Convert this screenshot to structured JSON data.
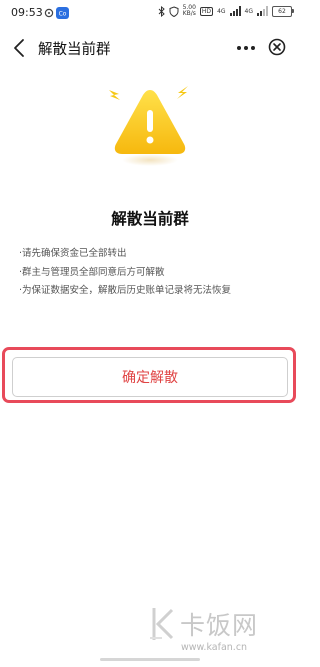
{
  "status_bar": {
    "time": "09:53",
    "speed_value": "5.00",
    "speed_unit": "KB/s",
    "hd_badge": "HD",
    "signal_label": "4G",
    "signal_label_2": "4G",
    "battery": "62"
  },
  "nav": {
    "title": "解散当前群"
  },
  "content": {
    "title": "解散当前群",
    "notes": [
      "·请先确保资金已全部转出",
      "·群主与管理员全部同意后方可解散",
      "·为保证数据安全，解散后历史账单记录将无法恢复"
    ],
    "confirm_label": "确定解散"
  },
  "watermark": {
    "name": "卡饭网",
    "url": "www.kafan.cn"
  },
  "colors": {
    "accent_red": "#e04444",
    "highlight_red": "#e84a5a",
    "warning_yellow": "#f6c814"
  }
}
